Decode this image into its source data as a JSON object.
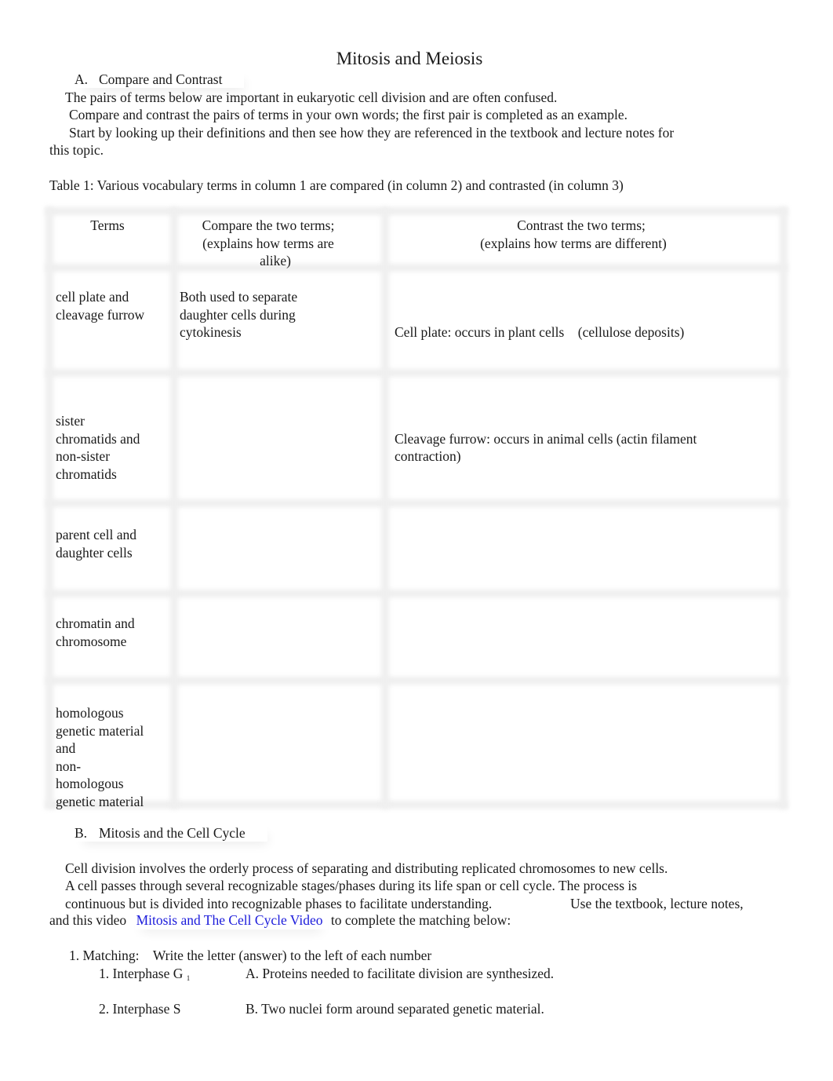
{
  "document": {
    "title": "Mitosis and Meiosis"
  },
  "section_a": {
    "letter": "A.",
    "heading": "Compare and Contrast",
    "paragraph_lines": [
      "The pairs of terms below are important in eukaryotic cell division and are often confused.",
      "Compare and contrast the pairs of terms in your own words; the first pair is completed as an example.",
      "Start by looking up their definitions and then see how they are referenced in the textbook and lecture notes for",
      "this topic."
    ],
    "table_caption": "Table 1: Various vocabulary terms in column 1 are compared (in column 2) and contrasted (in column 3)"
  },
  "table": {
    "headers": [
      "Terms",
      "Compare the two terms; (explains how terms are alike)",
      "Contrast the two terms; (explains how terms are different)"
    ],
    "header_lines": {
      "compare": [
        "Compare the two terms;",
        "(explains how terms are",
        "alike)"
      ],
      "contrast": [
        "Contrast the two terms;",
        "(explains how terms are different)"
      ]
    },
    "rows": [
      {
        "terms": "cell plate and cleavage furrow",
        "compare": "Both used to separate daughter cells during cytokinesis",
        "contrast_lines": [
          "Cell plate: occurs in plant cells    (cellulose deposits)",
          "Cleavage furrow: occurs in animal cells (actin filament contraction)"
        ]
      },
      {
        "terms": "sister chromatids and non-sister chromatids",
        "compare": "",
        "contrast_lines": []
      },
      {
        "terms": "parent cell and daughter cells",
        "compare": "",
        "contrast_lines": []
      },
      {
        "terms": "chromatin and chromosome",
        "compare": "",
        "contrast_lines": []
      },
      {
        "terms": "homologous genetic material and non-homologous genetic material",
        "compare": "",
        "contrast_lines": []
      }
    ],
    "term_lines": [
      [
        "cell plate and",
        "cleavage furrow"
      ],
      [
        "sister",
        "chromatids and",
        "non-sister",
        "chromatids"
      ],
      [
        "parent cell and",
        "daughter cells"
      ],
      [
        "chromatin and",
        "chromosome"
      ],
      [
        "homologous",
        "genetic material",
        "and",
        "non-",
        "homologous",
        "genetic material"
      ]
    ],
    "compare_lines_row1": [
      "Both used to separate",
      "daughter cells during",
      "cytokinesis"
    ]
  },
  "section_b": {
    "letter": "B.",
    "heading": "Mitosis and the Cell Cycle",
    "paragraph_lines": [
      "Cell division involves the orderly process of separating and distributing replicated chromosomes to new cells.",
      "A cell passes through several recognizable stages/phases during its life span or cell cycle. The process is",
      "continuous but is divided into recognizable phases to facilitate understanding.",
      "Use the textbook, lecture notes,"
    ],
    "last_line_prefix": "and this video",
    "link_text": "Mitosis and The Cell Cycle Video",
    "last_line_suffix": "to complete the matching below:",
    "link_color": "#1a1adb"
  },
  "matching": {
    "heading_number": "1. Matching:",
    "instruction": "Write the letter (answer) to the left of each number",
    "items": [
      {
        "term": "1. Interphase G",
        "subscript": "1",
        "answer": "A. Proteins needed to facilitate division are synthesized."
      },
      {
        "term": "2. Interphase S",
        "subscript": "",
        "answer": "B. Two nuclei form around separated genetic material."
      }
    ]
  }
}
